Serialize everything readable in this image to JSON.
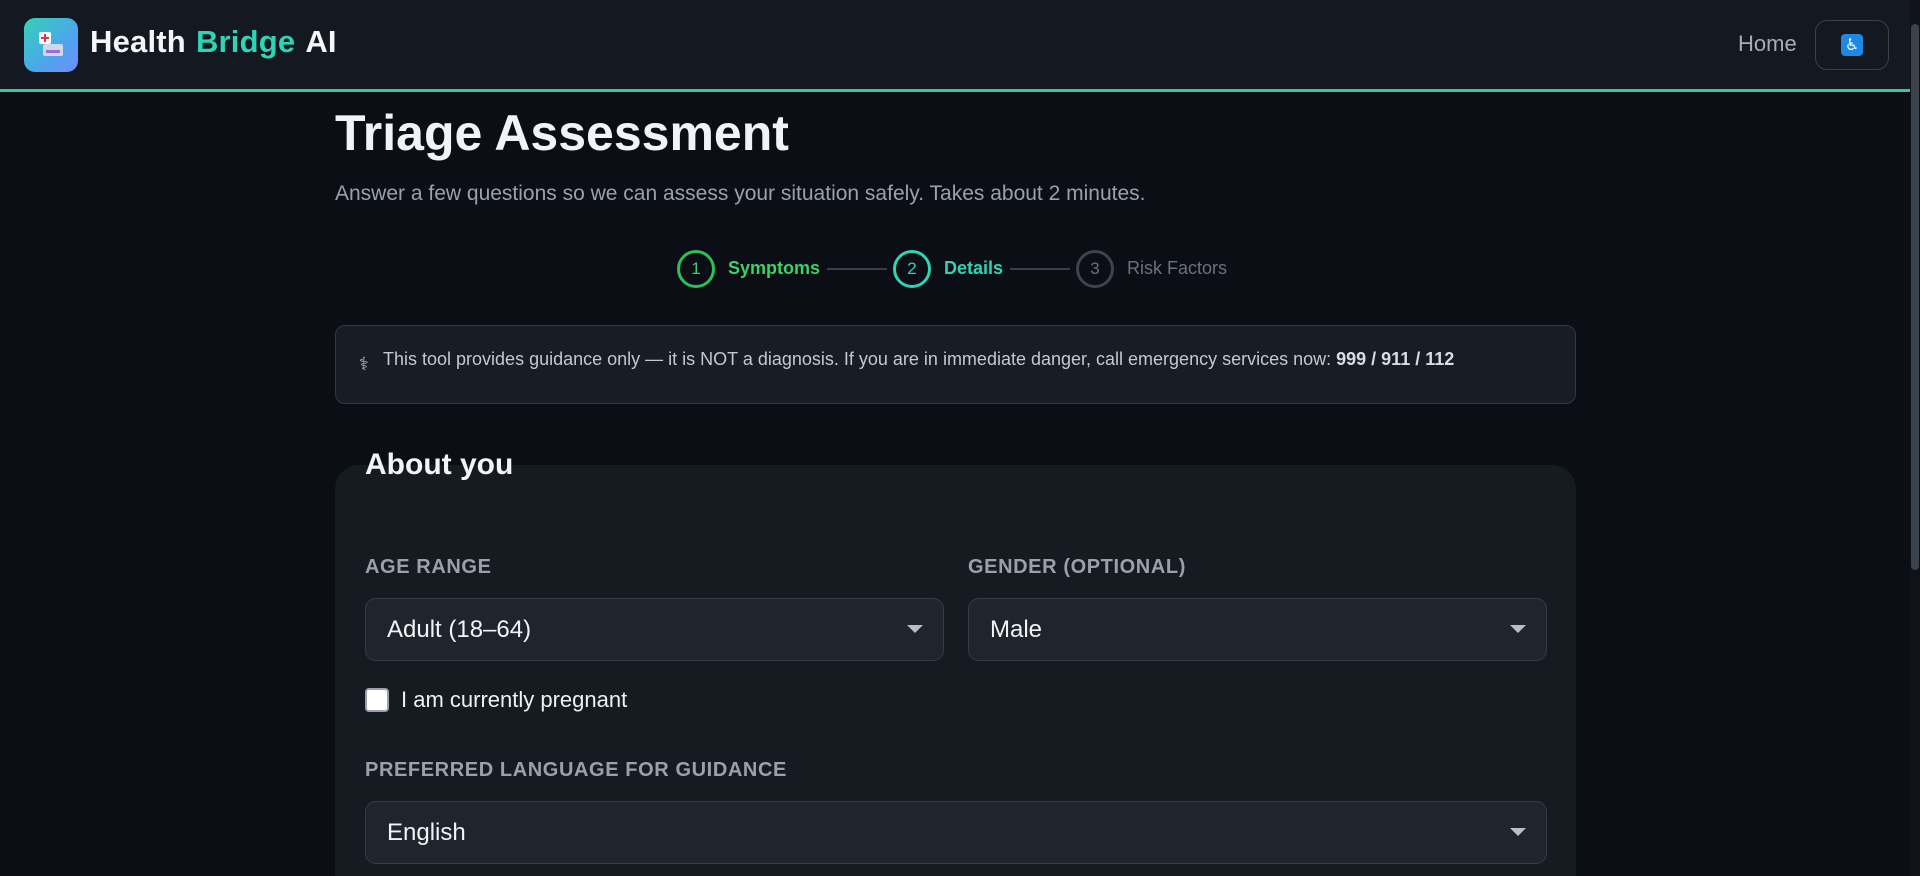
{
  "header": {
    "brand_part1": "Health",
    "brand_part2": "Bridge",
    "brand_part3": "AI",
    "nav_home": "Home",
    "accessibility_icon": "wheelchair-accessibility-icon",
    "logo_icon": "hospital-bed-icon"
  },
  "page": {
    "title": "Triage Assessment",
    "subtitle": "Answer a few questions so we can assess your situation safely. Takes about 2 minutes."
  },
  "stepper": {
    "steps": [
      {
        "number": "1",
        "label": "Symptoms",
        "state": "completed"
      },
      {
        "number": "2",
        "label": "Details",
        "state": "active"
      },
      {
        "number": "3",
        "label": "Risk Factors",
        "state": "upcoming"
      }
    ]
  },
  "disclaimer": {
    "icon": "medical-caduceus-icon",
    "text": "This tool provides guidance only — it is NOT a diagnosis. If you are in immediate danger, call emergency services now: ",
    "numbers": "999 / 911 / 112"
  },
  "form": {
    "section_title": "About you",
    "age_label": "AGE RANGE",
    "age_value": "Adult (18–64)",
    "gender_label": "GENDER (OPTIONAL)",
    "gender_value": "Male",
    "pregnant_label": "I am currently pregnant",
    "pregnant_checked": false,
    "language_label": "PREFERRED LANGUAGE FOR GUIDANCE",
    "language_value": "English"
  },
  "colors": {
    "accent_teal": "#2fd3b5",
    "accent_green": "#3cd168",
    "background": "#0b0e14"
  }
}
